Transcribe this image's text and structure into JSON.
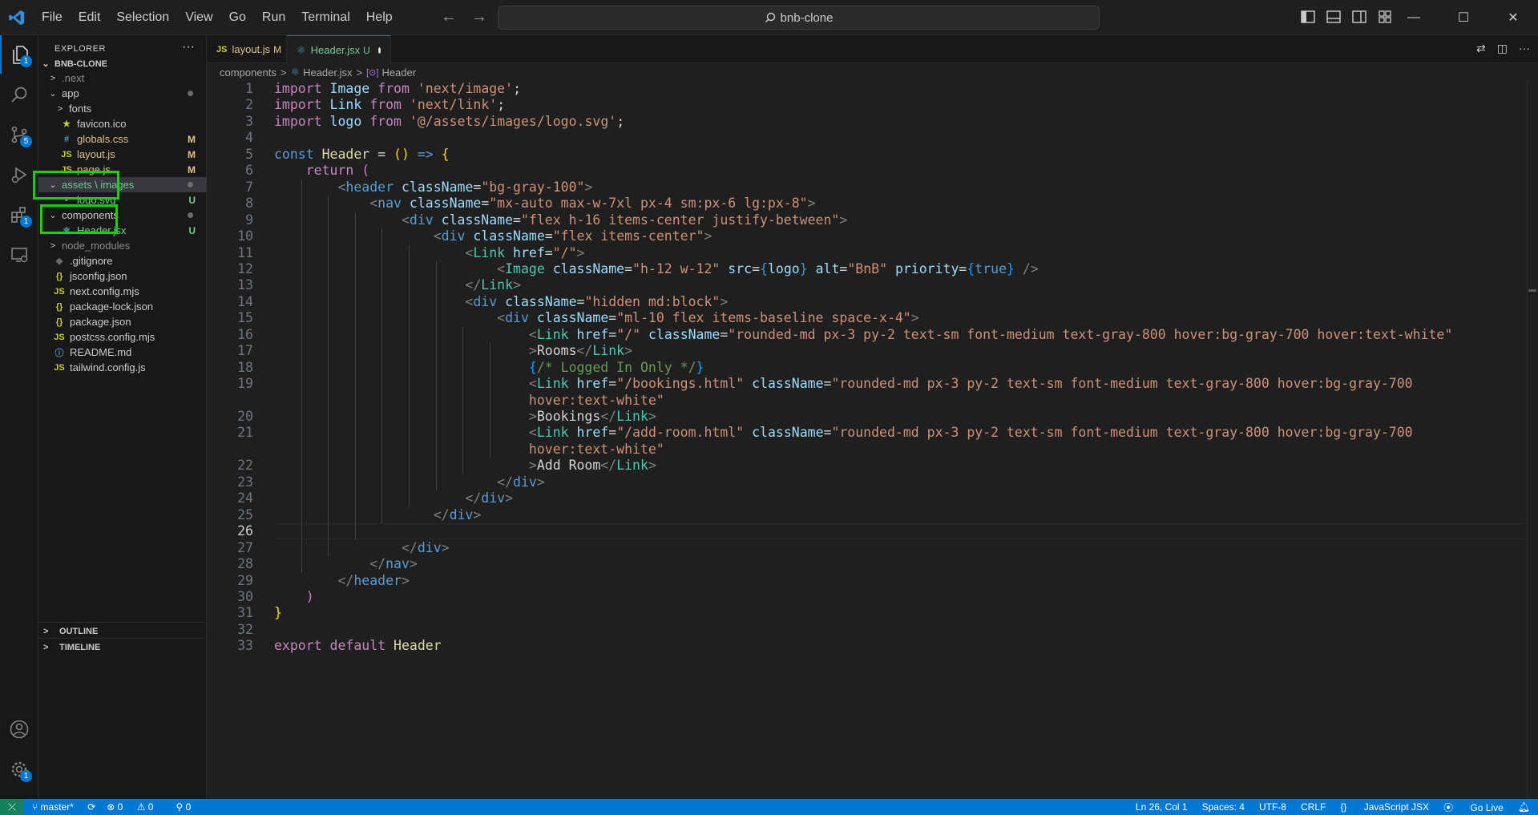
{
  "menu": [
    "File",
    "Edit",
    "Selection",
    "View",
    "Go",
    "Run",
    "Terminal",
    "Help"
  ],
  "search": {
    "text": "bnb-clone"
  },
  "activity": {
    "explorer_badge": "1",
    "scm_badge": "5",
    "extensions_badge": "1",
    "settings_badge": "1"
  },
  "sidebar": {
    "title": "EXPLORER",
    "project": "BNB-CLONE",
    "items": [
      {
        "label": ".next",
        "chev": ">",
        "icon": "",
        "status": "",
        "dim": true
      },
      {
        "label": "app",
        "chev": "⌄",
        "icon": "",
        "status": "dot"
      },
      {
        "label": "fonts",
        "chev": ">",
        "icon": "",
        "status": ""
      },
      {
        "label": "favicon.ico",
        "chev": "",
        "icon": "★",
        "status": ""
      },
      {
        "label": "globals.css",
        "chev": "",
        "icon": "#",
        "status": "M"
      },
      {
        "label": "layout.js",
        "chev": "",
        "icon": "JS",
        "status": "M"
      },
      {
        "label": "page.js",
        "chev": "",
        "icon": "JS",
        "status": "M"
      },
      {
        "label": "assets \\ images",
        "chev": "⌄",
        "icon": "",
        "status": "dot"
      },
      {
        "label": "logo.svg",
        "chev": "",
        "icon": "▪",
        "status": "U"
      },
      {
        "label": "components",
        "chev": "⌄",
        "icon": "",
        "status": "dot"
      },
      {
        "label": "Header.jsx",
        "chev": "",
        "icon": "⚛",
        "status": "U"
      },
      {
        "label": "node_modules",
        "chev": ">",
        "icon": "",
        "status": "",
        "dim": true
      },
      {
        "label": ".gitignore",
        "chev": "",
        "icon": "◆",
        "status": ""
      },
      {
        "label": "jsconfig.json",
        "chev": "",
        "icon": "{}",
        "status": ""
      },
      {
        "label": "next.config.mjs",
        "chev": "",
        "icon": "JS",
        "status": ""
      },
      {
        "label": "package-lock.json",
        "chev": "",
        "icon": "{}",
        "status": ""
      },
      {
        "label": "package.json",
        "chev": "",
        "icon": "{}",
        "status": ""
      },
      {
        "label": "postcss.config.mjs",
        "chev": "",
        "icon": "JS",
        "status": ""
      },
      {
        "label": "README.md",
        "chev": "",
        "icon": "ⓘ",
        "status": ""
      },
      {
        "label": "tailwind.config.js",
        "chev": "",
        "icon": "JS",
        "status": ""
      }
    ],
    "outline": "OUTLINE",
    "timeline": "TIMELINE"
  },
  "tabs": [
    {
      "label": "layout.js",
      "status": "M",
      "icon": "JS"
    },
    {
      "label": "Header.jsx",
      "status": "U",
      "icon": "⚛"
    }
  ],
  "breadcrumb": [
    "components",
    "Header.jsx",
    "Header"
  ],
  "editor": {
    "current_line": 26,
    "lines": [
      {
        "n": "1",
        "t": [
          [
            "kw2",
            "import"
          ],
          [
            "txt",
            " "
          ],
          [
            "var",
            "Image"
          ],
          [
            "txt",
            " "
          ],
          [
            "kw2",
            "from"
          ],
          [
            "txt",
            " "
          ],
          [
            "str",
            "'next/image'"
          ],
          [
            "txt",
            ";"
          ]
        ]
      },
      {
        "n": "2",
        "t": [
          [
            "kw2",
            "import"
          ],
          [
            "txt",
            " "
          ],
          [
            "var",
            "Link"
          ],
          [
            "txt",
            " "
          ],
          [
            "kw2",
            "from"
          ],
          [
            "txt",
            " "
          ],
          [
            "str",
            "'next/link'"
          ],
          [
            "txt",
            ";"
          ]
        ]
      },
      {
        "n": "3",
        "t": [
          [
            "kw2",
            "import"
          ],
          [
            "txt",
            " "
          ],
          [
            "var",
            "logo"
          ],
          [
            "txt",
            " "
          ],
          [
            "kw2",
            "from"
          ],
          [
            "txt",
            " "
          ],
          [
            "str",
            "'@/assets/images/logo.svg'"
          ],
          [
            "txt",
            ";"
          ]
        ]
      },
      {
        "n": "4",
        "t": []
      },
      {
        "n": "5",
        "t": [
          [
            "kw",
            "const"
          ],
          [
            "txt",
            " "
          ],
          [
            "fn",
            "Header"
          ],
          [
            "txt",
            " = "
          ],
          [
            "br1",
            "()"
          ],
          [
            "txt",
            " "
          ],
          [
            "kw",
            "=>"
          ],
          [
            "txt",
            " "
          ],
          [
            "br1",
            "{"
          ]
        ]
      },
      {
        "n": "6",
        "t": [
          [
            "txt",
            "    "
          ],
          [
            "kw2",
            "return"
          ],
          [
            "txt",
            " "
          ],
          [
            "br2",
            "("
          ]
        ]
      },
      {
        "n": "7",
        "t": [
          [
            "txt",
            "        "
          ],
          [
            "punc",
            "<"
          ],
          [
            "tag",
            "header"
          ],
          [
            "txt",
            " "
          ],
          [
            "attr",
            "className"
          ],
          [
            "txt",
            "="
          ],
          [
            "str",
            "\"bg-gray-100\""
          ],
          [
            "punc",
            ">"
          ]
        ]
      },
      {
        "n": "8",
        "t": [
          [
            "txt",
            "            "
          ],
          [
            "punc",
            "<"
          ],
          [
            "tag",
            "nav"
          ],
          [
            "txt",
            " "
          ],
          [
            "attr",
            "className"
          ],
          [
            "txt",
            "="
          ],
          [
            "str",
            "\"mx-auto max-w-7xl px-4 sm:px-6 lg:px-8\""
          ],
          [
            "punc",
            ">"
          ]
        ]
      },
      {
        "n": "9",
        "t": [
          [
            "txt",
            "                "
          ],
          [
            "punc",
            "<"
          ],
          [
            "tag",
            "div"
          ],
          [
            "txt",
            " "
          ],
          [
            "attr",
            "className"
          ],
          [
            "txt",
            "="
          ],
          [
            "str",
            "\"flex h-16 items-center justify-between\""
          ],
          [
            "punc",
            ">"
          ]
        ]
      },
      {
        "n": "10",
        "t": [
          [
            "txt",
            "                    "
          ],
          [
            "punc",
            "<"
          ],
          [
            "tag",
            "div"
          ],
          [
            "txt",
            " "
          ],
          [
            "attr",
            "className"
          ],
          [
            "txt",
            "="
          ],
          [
            "str",
            "\"flex items-center\""
          ],
          [
            "punc",
            ">"
          ]
        ]
      },
      {
        "n": "11",
        "t": [
          [
            "txt",
            "                        "
          ],
          [
            "punc",
            "<"
          ],
          [
            "comp",
            "Link"
          ],
          [
            "txt",
            " "
          ],
          [
            "attr",
            "href"
          ],
          [
            "txt",
            "="
          ],
          [
            "str",
            "\"/\""
          ],
          [
            "punc",
            ">"
          ]
        ]
      },
      {
        "n": "12",
        "t": [
          [
            "txt",
            "                            "
          ],
          [
            "punc",
            "<"
          ],
          [
            "comp",
            "Image"
          ],
          [
            "txt",
            " "
          ],
          [
            "attr",
            "className"
          ],
          [
            "txt",
            "="
          ],
          [
            "str",
            "\"h-12 w-12\""
          ],
          [
            "txt",
            " "
          ],
          [
            "attr",
            "src"
          ],
          [
            "txt",
            "="
          ],
          [
            "br3",
            "{"
          ],
          [
            "var",
            "logo"
          ],
          [
            "br3",
            "}"
          ],
          [
            "txt",
            " "
          ],
          [
            "attr",
            "alt"
          ],
          [
            "txt",
            "="
          ],
          [
            "str",
            "\"BnB\""
          ],
          [
            "txt",
            " "
          ],
          [
            "attr",
            "priority"
          ],
          [
            "txt",
            "="
          ],
          [
            "br3",
            "{"
          ],
          [
            "kw",
            "true"
          ],
          [
            "br3",
            "}"
          ],
          [
            "txt",
            " "
          ],
          [
            "punc",
            "/>"
          ]
        ]
      },
      {
        "n": "13",
        "t": [
          [
            "txt",
            "                        "
          ],
          [
            "punc",
            "</"
          ],
          [
            "comp",
            "Link"
          ],
          [
            "punc",
            ">"
          ]
        ]
      },
      {
        "n": "14",
        "t": [
          [
            "txt",
            "                        "
          ],
          [
            "punc",
            "<"
          ],
          [
            "tag",
            "div"
          ],
          [
            "txt",
            " "
          ],
          [
            "attr",
            "className"
          ],
          [
            "txt",
            "="
          ],
          [
            "str",
            "\"hidden md:block\""
          ],
          [
            "punc",
            ">"
          ]
        ]
      },
      {
        "n": "15",
        "t": [
          [
            "txt",
            "                            "
          ],
          [
            "punc",
            "<"
          ],
          [
            "tag",
            "div"
          ],
          [
            "txt",
            " "
          ],
          [
            "attr",
            "className"
          ],
          [
            "txt",
            "="
          ],
          [
            "str",
            "\"ml-10 flex items-baseline space-x-4\""
          ],
          [
            "punc",
            ">"
          ]
        ]
      },
      {
        "n": "16",
        "t": [
          [
            "txt",
            "                                "
          ],
          [
            "punc",
            "<"
          ],
          [
            "comp",
            "Link"
          ],
          [
            "txt",
            " "
          ],
          [
            "attr",
            "href"
          ],
          [
            "txt",
            "="
          ],
          [
            "str",
            "\"/\""
          ],
          [
            "txt",
            " "
          ],
          [
            "attr",
            "className"
          ],
          [
            "txt",
            "="
          ],
          [
            "str",
            "\"rounded-md px-3 py-2 text-sm font-medium text-gray-800 hover:bg-gray-700 hover:text-white\""
          ]
        ]
      },
      {
        "n": "17",
        "t": [
          [
            "txt",
            "                                "
          ],
          [
            "punc",
            ">"
          ],
          [
            "txt",
            "Rooms"
          ],
          [
            "punc",
            "</"
          ],
          [
            "comp",
            "Link"
          ],
          [
            "punc",
            ">"
          ]
        ]
      },
      {
        "n": "18",
        "t": [
          [
            "txt",
            "                                "
          ],
          [
            "br3",
            "{"
          ],
          [
            "cmt",
            "/* Logged In Only */"
          ],
          [
            "br3",
            "}"
          ]
        ]
      },
      {
        "n": "19",
        "t": [
          [
            "txt",
            "                                "
          ],
          [
            "punc",
            "<"
          ],
          [
            "comp",
            "Link"
          ],
          [
            "txt",
            " "
          ],
          [
            "attr",
            "href"
          ],
          [
            "txt",
            "="
          ],
          [
            "str",
            "\"/bookings.html\""
          ],
          [
            "txt",
            " "
          ],
          [
            "attr",
            "className"
          ],
          [
            "txt",
            "="
          ],
          [
            "str",
            "\"rounded-md px-3 py-2 text-sm font-medium text-gray-800 hover:bg-gray-700"
          ]
        ]
      },
      {
        "n": "",
        "t": [
          [
            "txt",
            "                                "
          ],
          [
            "str",
            "hover:text-white\""
          ]
        ]
      },
      {
        "n": "20",
        "t": [
          [
            "txt",
            "                                "
          ],
          [
            "punc",
            ">"
          ],
          [
            "txt",
            "Bookings"
          ],
          [
            "punc",
            "</"
          ],
          [
            "comp",
            "Link"
          ],
          [
            "punc",
            ">"
          ]
        ]
      },
      {
        "n": "21",
        "t": [
          [
            "txt",
            "                                "
          ],
          [
            "punc",
            "<"
          ],
          [
            "comp",
            "Link"
          ],
          [
            "txt",
            " "
          ],
          [
            "attr",
            "href"
          ],
          [
            "txt",
            "="
          ],
          [
            "str",
            "\"/add-room.html\""
          ],
          [
            "txt",
            " "
          ],
          [
            "attr",
            "className"
          ],
          [
            "txt",
            "="
          ],
          [
            "str",
            "\"rounded-md px-3 py-2 text-sm font-medium text-gray-800 hover:bg-gray-700"
          ]
        ]
      },
      {
        "n": "",
        "t": [
          [
            "txt",
            "                                "
          ],
          [
            "str",
            "hover:text-white\""
          ]
        ]
      },
      {
        "n": "22",
        "t": [
          [
            "txt",
            "                                "
          ],
          [
            "punc",
            ">"
          ],
          [
            "txt",
            "Add Room"
          ],
          [
            "punc",
            "</"
          ],
          [
            "comp",
            "Link"
          ],
          [
            "punc",
            ">"
          ]
        ]
      },
      {
        "n": "23",
        "t": [
          [
            "txt",
            "                            "
          ],
          [
            "punc",
            "</"
          ],
          [
            "tag",
            "div"
          ],
          [
            "punc",
            ">"
          ]
        ]
      },
      {
        "n": "24",
        "t": [
          [
            "txt",
            "                        "
          ],
          [
            "punc",
            "</"
          ],
          [
            "tag",
            "div"
          ],
          [
            "punc",
            ">"
          ]
        ]
      },
      {
        "n": "25",
        "t": [
          [
            "txt",
            "                    "
          ],
          [
            "punc",
            "</"
          ],
          [
            "tag",
            "div"
          ],
          [
            "punc",
            ">"
          ]
        ]
      },
      {
        "n": "26",
        "t": []
      },
      {
        "n": "27",
        "t": [
          [
            "txt",
            "                "
          ],
          [
            "punc",
            "</"
          ],
          [
            "tag",
            "div"
          ],
          [
            "punc",
            ">"
          ]
        ]
      },
      {
        "n": "28",
        "t": [
          [
            "txt",
            "            "
          ],
          [
            "punc",
            "</"
          ],
          [
            "tag",
            "nav"
          ],
          [
            "punc",
            ">"
          ]
        ]
      },
      {
        "n": "29",
        "t": [
          [
            "txt",
            "        "
          ],
          [
            "punc",
            "</"
          ],
          [
            "tag",
            "header"
          ],
          [
            "punc",
            ">"
          ]
        ]
      },
      {
        "n": "30",
        "t": [
          [
            "txt",
            "    "
          ],
          [
            "br2",
            ")"
          ]
        ]
      },
      {
        "n": "31",
        "t": [
          [
            "br1",
            "}"
          ]
        ]
      },
      {
        "n": "32",
        "t": []
      },
      {
        "n": "33",
        "t": [
          [
            "kw2",
            "export"
          ],
          [
            "txt",
            " "
          ],
          [
            "kw2",
            "default"
          ],
          [
            "txt",
            " "
          ],
          [
            "fn",
            "Header"
          ]
        ]
      }
    ]
  },
  "status": {
    "branch": "master*",
    "errors": "0",
    "warnings": "0",
    "ports": "0",
    "position": "Ln 26, Col 1",
    "spaces": "Spaces: 4",
    "encoding": "UTF-8",
    "eol": "CRLF",
    "language": "JavaScript JSX",
    "golive": "Go Live"
  },
  "colors": {
    "accent": "#0078d4",
    "highlight": "#19d10f",
    "modified": "#e2c08d",
    "untracked": "#73c991"
  }
}
